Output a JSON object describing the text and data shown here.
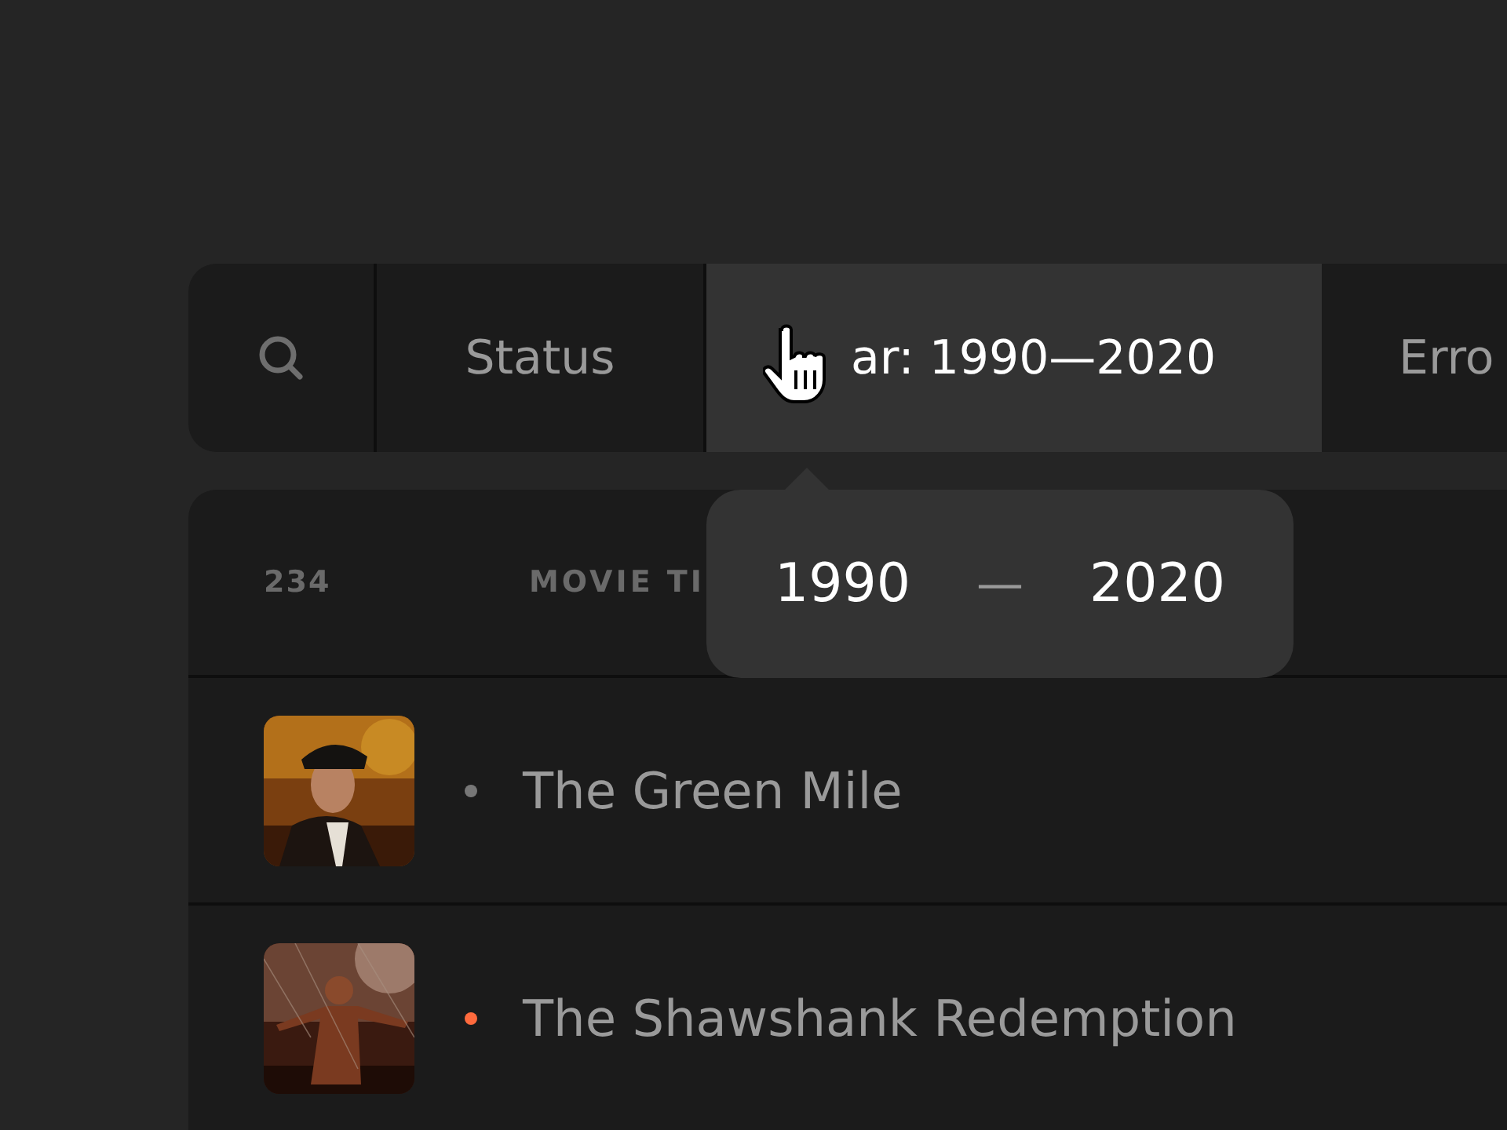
{
  "filter_bar": {
    "filters": [
      {
        "label": "Status",
        "selected": false
      },
      {
        "label": "ar: 1990—2020",
        "selected": true
      },
      {
        "label": "Erro",
        "selected": false
      }
    ]
  },
  "year_popover": {
    "from": "1990",
    "separator": "—",
    "to": "2020"
  },
  "table": {
    "count": "234",
    "columns": [
      "MOVIE TI"
    ],
    "rows": [
      {
        "title": "The Green Mile",
        "color": "#777777"
      },
      {
        "title": "The Shawshank Redemption",
        "color": "#ff6a3d"
      }
    ]
  }
}
